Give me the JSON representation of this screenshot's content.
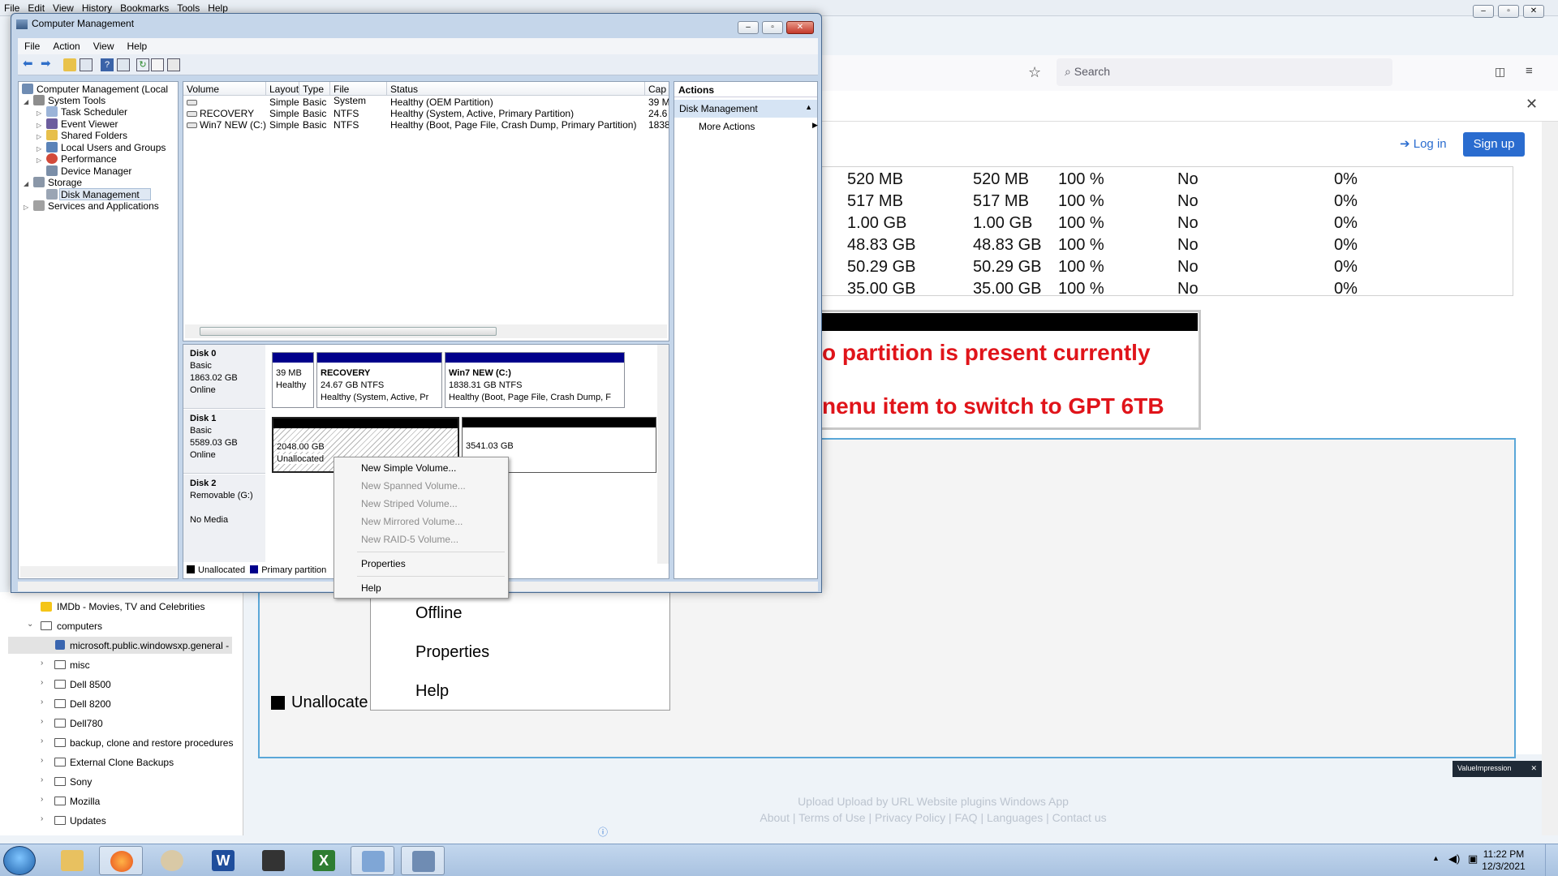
{
  "firefox": {
    "menubar": [
      "File",
      "Edit",
      "View",
      "History",
      "Bookmarks",
      "Tools",
      "Help"
    ],
    "search_placeholder": "Search",
    "login_label": "Log in",
    "signup_label": "Sign up",
    "disk_table_rows": [
      [
        "520 MB",
        "520 MB",
        "100 %",
        "No",
        "0%"
      ],
      [
        "517 MB",
        "517 MB",
        "100 %",
        "No",
        "0%"
      ],
      [
        "1.00 GB",
        "1.00 GB",
        "100 %",
        "No",
        "0%"
      ],
      [
        "48.83 GB",
        "48.83 GB",
        "100 %",
        "No",
        "0%"
      ],
      [
        "50.29 GB",
        "50.29 GB",
        "100 %",
        "No",
        "0%"
      ],
      [
        "35.00 GB",
        "35.00 GB",
        "100 %",
        "No",
        "0%"
      ]
    ],
    "screenshot_text_1": "o partition is present currently",
    "screenshot_text_2": "nenu item to switch to GPT 6TB",
    "big_menu": [
      "Offline",
      "Properties",
      "Help"
    ],
    "big_legend": "Unallocate",
    "footer_row1": "Upload   Upload by URL   Website plugins   Windows App",
    "footer_row2": "About | Terms of Use | Privacy Policy | FAQ | Languages | Contact us",
    "badge": "ValueImpression"
  },
  "bookmarks": [
    {
      "label": "IMDb - Movies, TV and Celebrities",
      "type": "bookmark"
    },
    {
      "label": "computers",
      "type": "folder-open"
    },
    {
      "label": "microsoft.public.windowsxp.general -",
      "type": "bookmark-selected"
    },
    {
      "label": "misc",
      "type": "folder"
    },
    {
      "label": "Dell 8500",
      "type": "folder"
    },
    {
      "label": "Dell 8200",
      "type": "folder"
    },
    {
      "label": "Dell780",
      "type": "folder"
    },
    {
      "label": "backup, clone and restore procedures",
      "type": "folder"
    },
    {
      "label": "External Clone Backups",
      "type": "folder"
    },
    {
      "label": "Sony",
      "type": "folder"
    },
    {
      "label": "Mozilla",
      "type": "folder"
    },
    {
      "label": "Updates",
      "type": "folder"
    }
  ],
  "cm": {
    "title": "Computer Management",
    "menu": [
      "File",
      "Action",
      "View",
      "Help"
    ],
    "tree": [
      {
        "label": "Computer Management (Local",
        "level": 0
      },
      {
        "label": "System Tools",
        "level": 1
      },
      {
        "label": "Task Scheduler",
        "level": 2
      },
      {
        "label": "Event Viewer",
        "level": 2
      },
      {
        "label": "Shared Folders",
        "level": 2
      },
      {
        "label": "Local Users and Groups",
        "level": 2
      },
      {
        "label": "Performance",
        "level": 2
      },
      {
        "label": "Device Manager",
        "level": 2
      },
      {
        "label": "Storage",
        "level": 1
      },
      {
        "label": "Disk Management",
        "level": 2
      },
      {
        "label": "Services and Applications",
        "level": 1
      }
    ],
    "vol_headers": [
      "Volume",
      "Layout",
      "Type",
      "File System",
      "Status",
      "Cap"
    ],
    "volumes": [
      [
        "",
        "Simple",
        "Basic",
        "",
        "Healthy (OEM Partition)",
        "39 M"
      ],
      [
        "RECOVERY",
        "Simple",
        "Basic",
        "NTFS",
        "Healthy (System, Active, Primary Partition)",
        "24.6"
      ],
      [
        "Win7 NEW (C:)",
        "Simple",
        "Basic",
        "NTFS",
        "Healthy (Boot, Page File, Crash Dump, Primary Partition)",
        "1838"
      ]
    ],
    "disks": {
      "d0": {
        "name": "Disk 0",
        "type": "Basic",
        "size": "1863.02 GB",
        "state": "Online"
      },
      "d0p1": {
        "size": "39 MB",
        "status": "Healthy"
      },
      "d0p2": {
        "name": "RECOVERY",
        "size": "24.67 GB NTFS",
        "status": "Healthy (System, Active, Pr"
      },
      "d0p3": {
        "name": "Win7 NEW  (C:)",
        "size": "1838.31 GB NTFS",
        "status": "Healthy (Boot, Page File, Crash Dump, F"
      },
      "d1": {
        "name": "Disk 1",
        "type": "Basic",
        "size": "5589.03 GB",
        "state": "Online"
      },
      "d1p1": {
        "size": "2048.00 GB",
        "status": "Unallocated"
      },
      "d1p2": {
        "size": "3541.03 GB"
      },
      "d2": {
        "name": "Disk 2",
        "type": "Removable (G:)",
        "state": "No Media"
      },
      "legend_unalloc": "Unallocated",
      "legend_primary": "Primary partition"
    },
    "actions": {
      "header": "Actions",
      "section": "Disk Management",
      "more": "More Actions"
    }
  },
  "context_menu": {
    "items": [
      {
        "label": "New Simple Volume...",
        "enabled": true
      },
      {
        "label": "New Spanned Volume...",
        "enabled": false
      },
      {
        "label": "New Striped Volume...",
        "enabled": false
      },
      {
        "label": "New Mirrored Volume...",
        "enabled": false
      },
      {
        "label": "New RAID-5 Volume...",
        "enabled": false
      },
      {
        "label": "Properties",
        "enabled": true
      },
      {
        "label": "Help",
        "enabled": true
      }
    ]
  },
  "taskbar": {
    "time": "11:22 PM",
    "date": "12/3/2021"
  },
  "colors": {
    "primary_partition": "#00008b",
    "unallocated": "#000000",
    "accent": "#2a6ccf",
    "red_text": "#e0141a"
  }
}
